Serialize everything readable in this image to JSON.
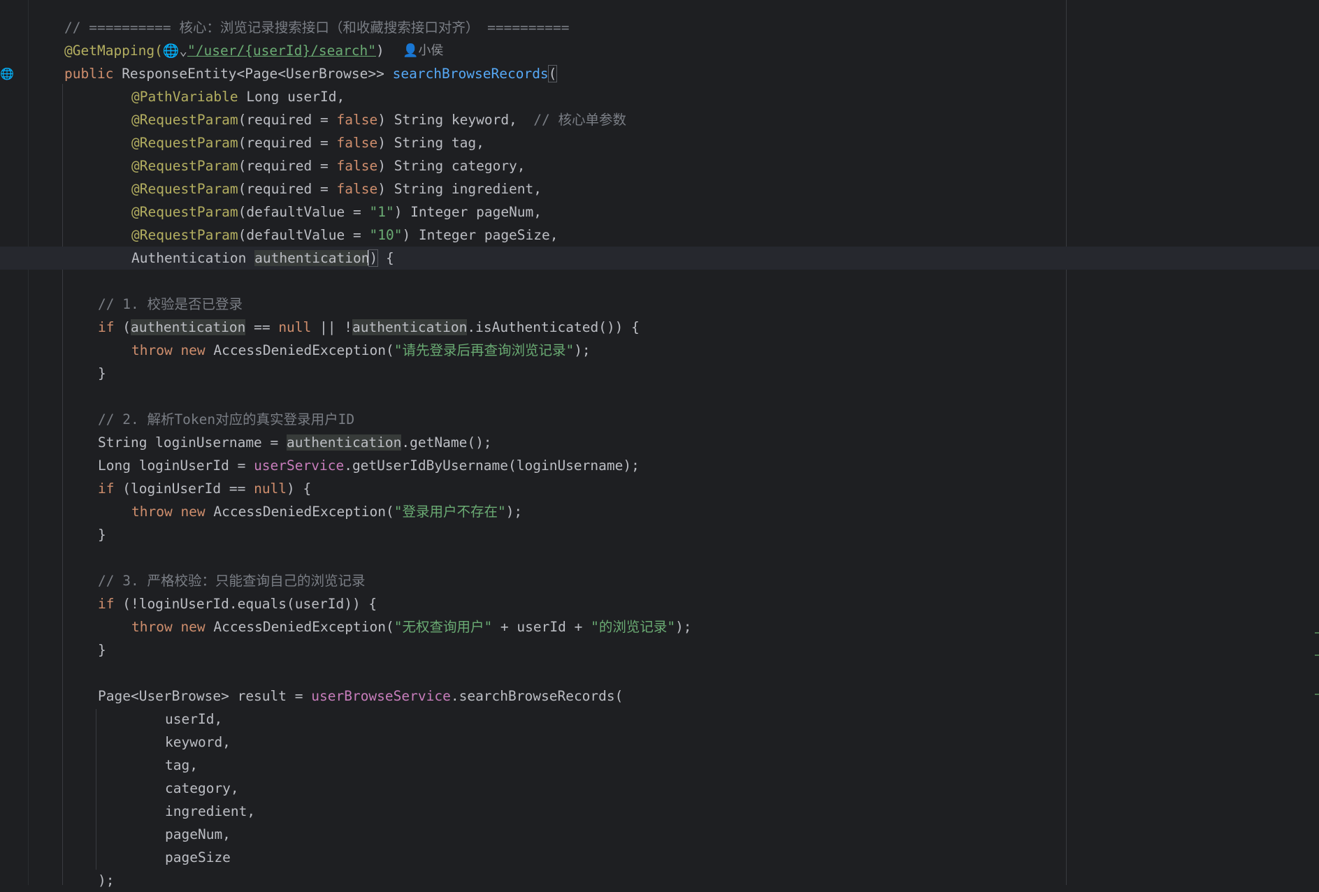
{
  "editor": {
    "header_comment": "// ========== 核心：浏览记录搜索接口（和收藏搜索接口对齐） ==========",
    "mapping_annotation": "@GetMapping(",
    "mapping_url": "\"/user/{userId}/search\"",
    "mapping_close": ")",
    "author": "小侯",
    "sig_public": "public ",
    "sig_return": "ResponseEntity<Page<UserBrowse>> ",
    "sig_name": "searchBrowseRecords",
    "sig_paren": "(",
    "p1_ann": "@PathVariable",
    "p1_rest": " Long userId,",
    "p2_ann": "@RequestParam",
    "p2_a": "(required = ",
    "p2_false": "false",
    "p2_b": ") String keyword,  ",
    "p2_comment": "// 核心单参数",
    "p3_ann": "@RequestParam",
    "p3_a": "(required = ",
    "p3_false": "false",
    "p3_b": ") String tag,",
    "p4_ann": "@RequestParam",
    "p4_a": "(required = ",
    "p4_false": "false",
    "p4_b": ") String category,",
    "p5_ann": "@RequestParam",
    "p5_a": "(required = ",
    "p5_false": "false",
    "p5_b": ") String ingredient,",
    "p6_ann": "@RequestParam",
    "p6_a": "(defaultValue = ",
    "p6_val": "\"1\"",
    "p6_b": ") Integer pageNum,",
    "p7_ann": "@RequestParam",
    "p7_a": "(defaultValue = ",
    "p7_val": "\"10\"",
    "p7_b": ") Integer pageSize,",
    "p8_type": "Authentication ",
    "p8_name": "authentication",
    "p8_close": ")",
    "p8_brace": " {",
    "c1": "// 1. 校验是否已登录",
    "if1_kw": "if",
    "if1_a": " (",
    "if1_auth": "authentication",
    "if1_b": " == ",
    "if1_null": "null",
    "if1_c": " || !",
    "if1_auth2": "authentication",
    "if1_d": ".isAuthenticated()) {",
    "throw1_kw": "throw new",
    "throw1_a": " AccessDeniedException(",
    "throw1_str": "\"请先登录后再查询浏览记录\"",
    "throw1_b": ");",
    "close1": "}",
    "c2": "// 2. 解析Token对应的真实登录用户ID",
    "s1_a": "String loginUsername = ",
    "s1_auth": "authentication",
    "s1_b": ".getName();",
    "s2_a": "Long loginUserId = ",
    "s2_svc": "userService",
    "s2_b": ".getUserIdByUsername(loginUsername);",
    "if2_kw": "if",
    "if2_a": " (loginUserId == ",
    "if2_null": "null",
    "if2_b": ") {",
    "throw2_kw": "throw new",
    "throw2_a": " AccessDeniedException(",
    "throw2_str": "\"登录用户不存在\"",
    "throw2_b": ");",
    "close2": "}",
    "c3": "// 3. 严格校验：只能查询自己的浏览记录",
    "if3_kw": "if",
    "if3_a": " (!loginUserId.equals(userId)) {",
    "throw3_kw": "throw new",
    "throw3_a": " AccessDeniedException(",
    "throw3_str1": "\"无权查询用户\"",
    "throw3_b": " + userId + ",
    "throw3_str2": "\"的浏览记录\"",
    "throw3_c": ");",
    "close3": "}",
    "r_a": "Page<UserBrowse> result = ",
    "r_svc": "userBrowseService",
    "r_b": ".searchBrowseRecords(",
    "a1": "userId,",
    "a2": "keyword,",
    "a3": "tag,",
    "a4": "category,",
    "a5": "ingredient,",
    "a6": "pageNum,",
    "a7": "pageSize",
    "r_end": ");"
  },
  "icons": {
    "globe": "globe-icon",
    "author": "user-icon",
    "bulb": "lightbulb-icon",
    "endpoint": "endpoint-gutter-icon"
  }
}
